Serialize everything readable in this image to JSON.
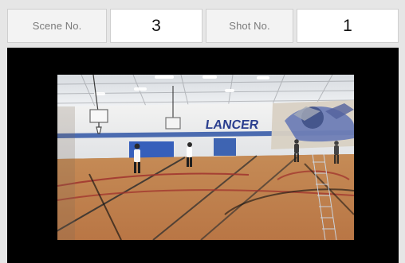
{
  "header": {
    "scene_label": "Scene No.",
    "scene_value": "3",
    "shot_label": "Shot No.",
    "shot_value": "1"
  },
  "video": {
    "wall_text": "LANCER"
  },
  "colors": {
    "background": "#e6e6e6",
    "panel": "#000000",
    "cell_bg": "#ffffff",
    "cell_border": "#cfcfcf",
    "label_text": "#7a7a7a",
    "value_text": "#111111"
  }
}
